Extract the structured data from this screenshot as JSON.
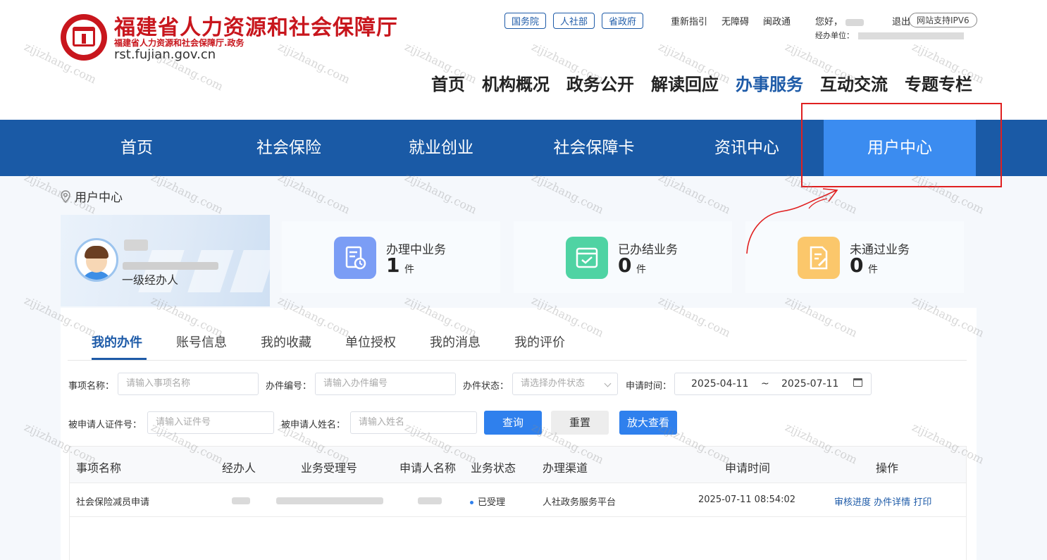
{
  "header": {
    "site_title": "福建省人力资源和社会保障厅",
    "site_subtitle": "福建省人力资源和社会保障厅.政务",
    "site_url": "rst.fujian.gov.cn",
    "badges": [
      "国务院",
      "人社部",
      "省政府"
    ],
    "top_links": [
      "重新指引",
      "无障碍",
      "闽政通"
    ],
    "greeting": "您好，",
    "logout": "退出",
    "ipv6": "网站支持IPV6",
    "unit_label": "经办单位：",
    "main_nav": [
      "首页",
      "机构概况",
      "政务公开",
      "解读回应",
      "办事服务",
      "互动交流",
      "专题专栏"
    ],
    "main_nav_active": "办事服务"
  },
  "blue_nav": {
    "tabs": [
      "首页",
      "社会保险",
      "就业创业",
      "社会保障卡",
      "资讯中心",
      "用户中心"
    ],
    "active": "用户中心"
  },
  "breadcrumb": "用户中心",
  "profile": {
    "role": "一级经办人"
  },
  "stats": [
    {
      "label": "办理中业务",
      "value": "1",
      "unit": "件",
      "color": "#7b9df5"
    },
    {
      "label": "已办结业务",
      "value": "0",
      "unit": "件",
      "color": "#4fd3a3"
    },
    {
      "label": "未通过业务",
      "value": "0",
      "unit": "件",
      "color": "#fbc76b"
    }
  ],
  "tabs": [
    "我的办件",
    "账号信息",
    "我的收藏",
    "单位授权",
    "我的消息",
    "我的评价"
  ],
  "filters": {
    "item_name_label": "事项名称：",
    "item_name_placeholder": "请输入事项名称",
    "case_no_label": "办件编号：",
    "case_no_placeholder": "请输入办件编号",
    "status_label": "办件状态：",
    "status_placeholder": "请选择办件状态",
    "date_label": "申请时间：",
    "date_start": "2025-04-11",
    "date_sep": "~",
    "date_end": "2025-07-11",
    "id_label": "被申请人证件号：",
    "id_placeholder": "请输入证件号",
    "applicant_label": "被申请人姓名：",
    "applicant_placeholder": "请输入姓名",
    "query_btn": "查询",
    "reset_btn": "重置",
    "zoom_btn": "放大查看"
  },
  "table": {
    "headers": [
      "事项名称",
      "经办人",
      "业务受理号",
      "申请人名称",
      "业务状态",
      "办理渠道",
      "申请时间",
      "操作"
    ],
    "rows": [
      {
        "item_name": "社会保险减员申请",
        "status": "已受理",
        "channel": "人社政务服务平台",
        "time": "2025-07-11 08:54:02",
        "ops": [
          "审核进度",
          "办件详情",
          "打印"
        ]
      }
    ]
  },
  "watermark": "zijizhang.com",
  "colors": {
    "brand_red": "#c8161d",
    "nav_blue": "#1a5aa6",
    "nav_active": "#3b8cf0",
    "link_blue": "#1e5ba8",
    "button_blue": "#2f80ed"
  }
}
